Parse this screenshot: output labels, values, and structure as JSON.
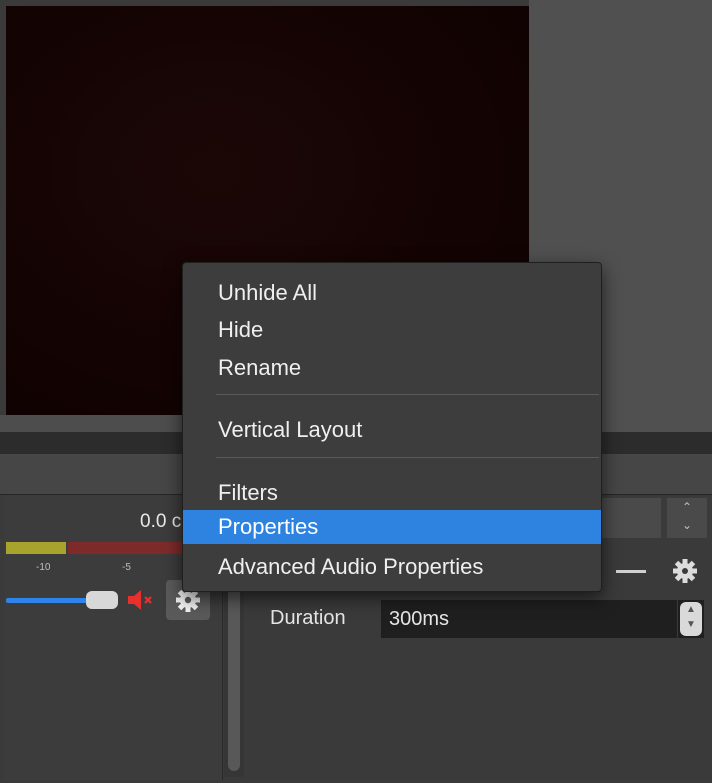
{
  "mixer": {
    "value_text": "0.0 c",
    "ticks": [
      "-10",
      "-5"
    ],
    "volume_level": 0.8,
    "muted": true,
    "colors": {
      "meter_low": "#a7a32d",
      "meter_high": "#7e2a2a",
      "slider": "#2e84ea",
      "mute": "#e8302c"
    }
  },
  "transition": {
    "duration_label": "Duration",
    "duration_value": "300ms",
    "spinner_symbol": "◇"
  },
  "context_menu": {
    "items": [
      {
        "label": "Unhide All"
      },
      {
        "label": "Hide"
      },
      {
        "label": "Rename"
      },
      {
        "label": "Vertical Layout"
      },
      {
        "label": "Filters"
      },
      {
        "label": "Properties",
        "highlighted": true
      },
      {
        "label": "Advanced Audio Properties"
      }
    ],
    "highlight_color": "#2e83e1"
  },
  "icons": [
    "gear-icon",
    "mute-icon",
    "spinner-icon",
    "minus-icon"
  ]
}
